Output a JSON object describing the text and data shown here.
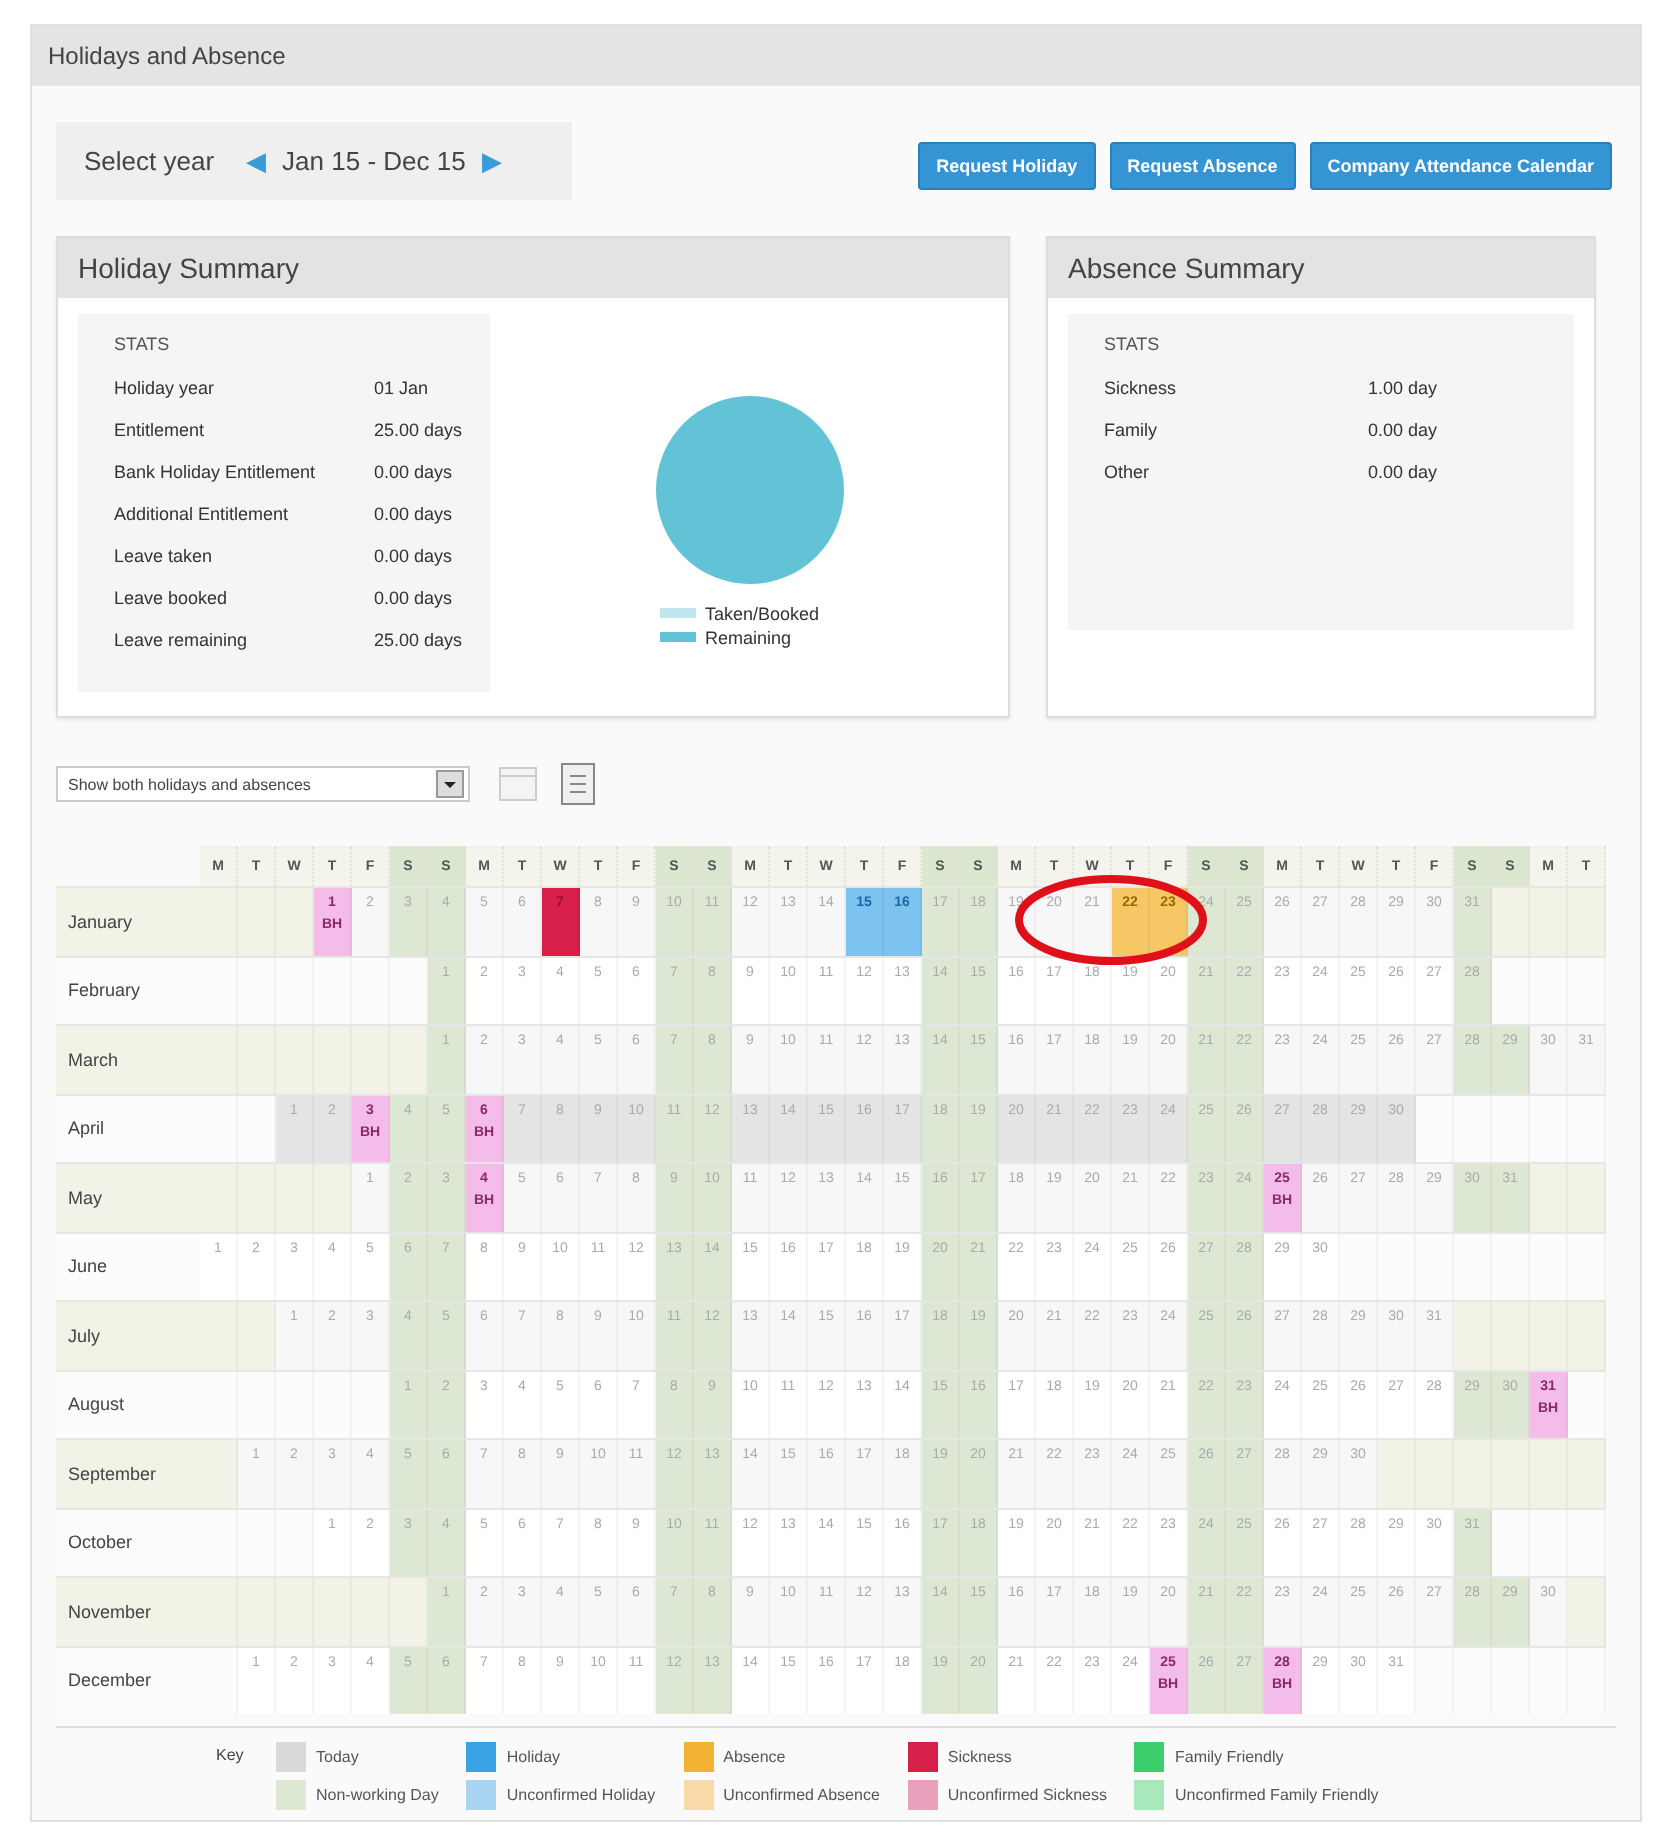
{
  "title": "Holidays and Absence",
  "year_selector": {
    "label": "Select year",
    "prev": "◀",
    "range": "Jan 15 - Dec 15",
    "next": "▶"
  },
  "buttons": [
    "Request Holiday",
    "Request Absence",
    "Company Attendance Calendar"
  ],
  "holiday_summary": {
    "title": "Holiday Summary",
    "stats_heading": "STATS",
    "stats": [
      {
        "label": "Holiday year",
        "value": "01 Jan"
      },
      {
        "label": "Entitlement",
        "value": "25.00 days"
      },
      {
        "label": "Bank Holiday Entitlement",
        "value": "0.00 days"
      },
      {
        "label": "Additional Entitlement",
        "value": "0.00 days"
      },
      {
        "label": "Leave taken",
        "value": "0.00 days"
      },
      {
        "label": "Leave booked",
        "value": "0.00 days"
      },
      {
        "label": "Leave remaining",
        "value": "25.00 days"
      }
    ],
    "legend": [
      {
        "label": "Taken/Booked",
        "color": "#bfe6ef"
      },
      {
        "label": "Remaining",
        "color": "#62c3d6"
      }
    ]
  },
  "absence_summary": {
    "title": "Absence Summary",
    "stats_heading": "STATS",
    "stats": [
      {
        "label": "Sickness",
        "value": "1.00 day"
      },
      {
        "label": "Family",
        "value": "0.00 day"
      },
      {
        "label": "Other",
        "value": "0.00 day"
      }
    ]
  },
  "filter": {
    "value": "Show both holidays and absences"
  },
  "calendar": {
    "weekdays": [
      {
        "label": "M",
        "weekend": false
      },
      {
        "label": "T",
        "weekend": false
      },
      {
        "label": "W",
        "weekend": false
      },
      {
        "label": "T",
        "weekend": false
      },
      {
        "label": "F",
        "weekend": false
      },
      {
        "label": "S",
        "weekend": true
      },
      {
        "label": "S",
        "weekend": true
      },
      {
        "label": "M",
        "weekend": false
      },
      {
        "label": "T",
        "weekend": false
      },
      {
        "label": "W",
        "weekend": false
      },
      {
        "label": "T",
        "weekend": false
      },
      {
        "label": "F",
        "weekend": false
      },
      {
        "label": "S",
        "weekend": true
      },
      {
        "label": "S",
        "weekend": true
      },
      {
        "label": "M",
        "weekend": false
      },
      {
        "label": "T",
        "weekend": false
      },
      {
        "label": "W",
        "weekend": false
      },
      {
        "label": "T",
        "weekend": false
      },
      {
        "label": "F",
        "weekend": false
      },
      {
        "label": "S",
        "weekend": true
      },
      {
        "label": "S",
        "weekend": true
      },
      {
        "label": "M",
        "weekend": false
      },
      {
        "label": "T",
        "weekend": false
      },
      {
        "label": "W",
        "weekend": false
      },
      {
        "label": "T",
        "weekend": false
      },
      {
        "label": "F",
        "weekend": false
      },
      {
        "label": "S",
        "weekend": true
      },
      {
        "label": "S",
        "weekend": true
      },
      {
        "label": "M",
        "weekend": false
      },
      {
        "label": "T",
        "weekend": false
      },
      {
        "label": "W",
        "weekend": false
      },
      {
        "label": "T",
        "weekend": false
      },
      {
        "label": "F",
        "weekend": false
      },
      {
        "label": "S",
        "weekend": true
      },
      {
        "label": "S",
        "weekend": true
      },
      {
        "label": "M",
        "weekend": false
      },
      {
        "label": "T",
        "weekend": false
      }
    ],
    "months": [
      {
        "name": "January",
        "current": false,
        "days": [
          {
            "kind": "blank"
          },
          {
            "kind": "blank"
          },
          {
            "kind": "blank"
          },
          {
            "n": "1",
            "kind": "bank_holiday",
            "note": "BH"
          },
          {
            "n": "2"
          },
          {
            "n": "3"
          },
          {
            "n": "4"
          },
          {
            "n": "5"
          },
          {
            "n": "6"
          },
          {
            "n": "7",
            "kind": "sickness"
          },
          {
            "n": "8"
          },
          {
            "n": "9"
          },
          {
            "n": "10"
          },
          {
            "n": "11"
          },
          {
            "n": "12"
          },
          {
            "n": "13"
          },
          {
            "n": "14"
          },
          {
            "n": "15",
            "kind": "holiday"
          },
          {
            "n": "16",
            "kind": "holiday"
          },
          {
            "n": "17"
          },
          {
            "n": "18"
          },
          {
            "n": "19"
          },
          {
            "n": "20"
          },
          {
            "n": "21"
          },
          {
            "n": "22",
            "kind": "absence"
          },
          {
            "n": "23",
            "kind": "absence"
          },
          {
            "n": "24"
          },
          {
            "n": "25"
          },
          {
            "n": "26"
          },
          {
            "n": "27"
          },
          {
            "n": "28"
          },
          {
            "n": "29"
          },
          {
            "n": "30"
          },
          {
            "n": "31"
          }
        ]
      },
      {
        "name": "February",
        "current": false,
        "days": [
          {
            "kind": "blank"
          },
          {
            "kind": "blank"
          },
          {
            "kind": "blank"
          },
          {
            "kind": "blank"
          },
          {
            "kind": "blank"
          },
          {
            "kind": "blank"
          },
          {
            "n": "1"
          },
          {
            "n": "2"
          },
          {
            "n": "3"
          },
          {
            "n": "4"
          },
          {
            "n": "5"
          },
          {
            "n": "6"
          },
          {
            "n": "7"
          },
          {
            "n": "8"
          },
          {
            "n": "9"
          },
          {
            "n": "10"
          },
          {
            "n": "11"
          },
          {
            "n": "12"
          },
          {
            "n": "13"
          },
          {
            "n": "14"
          },
          {
            "n": "15"
          },
          {
            "n": "16"
          },
          {
            "n": "17"
          },
          {
            "n": "18"
          },
          {
            "n": "19"
          },
          {
            "n": "20"
          },
          {
            "n": "21"
          },
          {
            "n": "22"
          },
          {
            "n": "23"
          },
          {
            "n": "24"
          },
          {
            "n": "25"
          },
          {
            "n": "26"
          },
          {
            "n": "27"
          },
          {
            "n": "28"
          }
        ]
      },
      {
        "name": "March",
        "current": false,
        "days": [
          {
            "kind": "blank"
          },
          {
            "kind": "blank"
          },
          {
            "kind": "blank"
          },
          {
            "kind": "blank"
          },
          {
            "kind": "blank"
          },
          {
            "kind": "blank"
          },
          {
            "n": "1"
          },
          {
            "n": "2"
          },
          {
            "n": "3"
          },
          {
            "n": "4"
          },
          {
            "n": "5"
          },
          {
            "n": "6"
          },
          {
            "n": "7"
          },
          {
            "n": "8"
          },
          {
            "n": "9"
          },
          {
            "n": "10"
          },
          {
            "n": "11"
          },
          {
            "n": "12"
          },
          {
            "n": "13"
          },
          {
            "n": "14"
          },
          {
            "n": "15"
          },
          {
            "n": "16"
          },
          {
            "n": "17"
          },
          {
            "n": "18"
          },
          {
            "n": "19"
          },
          {
            "n": "20"
          },
          {
            "n": "21"
          },
          {
            "n": "22"
          },
          {
            "n": "23"
          },
          {
            "n": "24"
          },
          {
            "n": "25"
          },
          {
            "n": "26"
          },
          {
            "n": "27"
          },
          {
            "n": "28"
          },
          {
            "n": "29"
          },
          {
            "n": "30"
          },
          {
            "n": "31"
          }
        ]
      },
      {
        "name": "April",
        "current": true,
        "days": [
          {
            "kind": "blank"
          },
          {
            "kind": "blank"
          },
          {
            "n": "1"
          },
          {
            "n": "2"
          },
          {
            "n": "3",
            "kind": "bank_holiday",
            "note": "BH"
          },
          {
            "n": "4"
          },
          {
            "n": "5"
          },
          {
            "n": "6",
            "kind": "bank_holiday",
            "note": "BH"
          },
          {
            "n": "7"
          },
          {
            "n": "8"
          },
          {
            "n": "9"
          },
          {
            "n": "10"
          },
          {
            "n": "11"
          },
          {
            "n": "12"
          },
          {
            "n": "13"
          },
          {
            "n": "14"
          },
          {
            "n": "15"
          },
          {
            "n": "16"
          },
          {
            "n": "17"
          },
          {
            "n": "18"
          },
          {
            "n": "19"
          },
          {
            "n": "20"
          },
          {
            "n": "21"
          },
          {
            "n": "22"
          },
          {
            "n": "23"
          },
          {
            "n": "24"
          },
          {
            "n": "25"
          },
          {
            "n": "26"
          },
          {
            "n": "27"
          },
          {
            "n": "28"
          },
          {
            "n": "29"
          },
          {
            "n": "30"
          }
        ]
      },
      {
        "name": "May",
        "current": false,
        "days": [
          {
            "kind": "blank"
          },
          {
            "kind": "blank"
          },
          {
            "kind": "blank"
          },
          {
            "kind": "blank"
          },
          {
            "n": "1"
          },
          {
            "n": "2"
          },
          {
            "n": "3"
          },
          {
            "n": "4",
            "kind": "bank_holiday",
            "note": "BH"
          },
          {
            "n": "5"
          },
          {
            "n": "6"
          },
          {
            "n": "7"
          },
          {
            "n": "8"
          },
          {
            "n": "9"
          },
          {
            "n": "10"
          },
          {
            "n": "11"
          },
          {
            "n": "12"
          },
          {
            "n": "13"
          },
          {
            "n": "14"
          },
          {
            "n": "15"
          },
          {
            "n": "16"
          },
          {
            "n": "17"
          },
          {
            "n": "18"
          },
          {
            "n": "19"
          },
          {
            "n": "20"
          },
          {
            "n": "21"
          },
          {
            "n": "22"
          },
          {
            "n": "23"
          },
          {
            "n": "24"
          },
          {
            "n": "25",
            "kind": "bank_holiday",
            "note": "BH"
          },
          {
            "n": "26"
          },
          {
            "n": "27"
          },
          {
            "n": "28"
          },
          {
            "n": "29"
          },
          {
            "n": "30"
          },
          {
            "n": "31"
          }
        ]
      },
      {
        "name": "June",
        "current": false,
        "days": [
          {
            "n": "1"
          },
          {
            "n": "2"
          },
          {
            "n": "3"
          },
          {
            "n": "4"
          },
          {
            "n": "5"
          },
          {
            "n": "6"
          },
          {
            "n": "7"
          },
          {
            "n": "8"
          },
          {
            "n": "9"
          },
          {
            "n": "10"
          },
          {
            "n": "11"
          },
          {
            "n": "12"
          },
          {
            "n": "13"
          },
          {
            "n": "14"
          },
          {
            "n": "15"
          },
          {
            "n": "16"
          },
          {
            "n": "17"
          },
          {
            "n": "18"
          },
          {
            "n": "19"
          },
          {
            "n": "20"
          },
          {
            "n": "21"
          },
          {
            "n": "22"
          },
          {
            "n": "23"
          },
          {
            "n": "24"
          },
          {
            "n": "25"
          },
          {
            "n": "26"
          },
          {
            "n": "27"
          },
          {
            "n": "28"
          },
          {
            "n": "29"
          },
          {
            "n": "30"
          }
        ]
      },
      {
        "name": "July",
        "current": false,
        "days": [
          {
            "kind": "blank"
          },
          {
            "kind": "blank"
          },
          {
            "n": "1"
          },
          {
            "n": "2"
          },
          {
            "n": "3"
          },
          {
            "n": "4"
          },
          {
            "n": "5"
          },
          {
            "n": "6"
          },
          {
            "n": "7"
          },
          {
            "n": "8"
          },
          {
            "n": "9"
          },
          {
            "n": "10"
          },
          {
            "n": "11"
          },
          {
            "n": "12"
          },
          {
            "n": "13"
          },
          {
            "n": "14"
          },
          {
            "n": "15"
          },
          {
            "n": "16"
          },
          {
            "n": "17"
          },
          {
            "n": "18"
          },
          {
            "n": "19"
          },
          {
            "n": "20"
          },
          {
            "n": "21"
          },
          {
            "n": "22"
          },
          {
            "n": "23"
          },
          {
            "n": "24"
          },
          {
            "n": "25"
          },
          {
            "n": "26"
          },
          {
            "n": "27"
          },
          {
            "n": "28"
          },
          {
            "n": "29"
          },
          {
            "n": "30"
          },
          {
            "n": "31"
          }
        ]
      },
      {
        "name": "August",
        "current": false,
        "days": [
          {
            "kind": "blank"
          },
          {
            "kind": "blank"
          },
          {
            "kind": "blank"
          },
          {
            "kind": "blank"
          },
          {
            "kind": "blank"
          },
          {
            "n": "1"
          },
          {
            "n": "2"
          },
          {
            "n": "3"
          },
          {
            "n": "4"
          },
          {
            "n": "5"
          },
          {
            "n": "6"
          },
          {
            "n": "7"
          },
          {
            "n": "8"
          },
          {
            "n": "9"
          },
          {
            "n": "10"
          },
          {
            "n": "11"
          },
          {
            "n": "12"
          },
          {
            "n": "13"
          },
          {
            "n": "14"
          },
          {
            "n": "15"
          },
          {
            "n": "16"
          },
          {
            "n": "17"
          },
          {
            "n": "18"
          },
          {
            "n": "19"
          },
          {
            "n": "20"
          },
          {
            "n": "21"
          },
          {
            "n": "22"
          },
          {
            "n": "23"
          },
          {
            "n": "24"
          },
          {
            "n": "25"
          },
          {
            "n": "26"
          },
          {
            "n": "27"
          },
          {
            "n": "28"
          },
          {
            "n": "29"
          },
          {
            "n": "30"
          },
          {
            "n": "31",
            "kind": "bank_holiday",
            "note": "BH"
          }
        ]
      },
      {
        "name": "September",
        "current": false,
        "days": [
          {
            "kind": "blank"
          },
          {
            "n": "1"
          },
          {
            "n": "2"
          },
          {
            "n": "3"
          },
          {
            "n": "4"
          },
          {
            "n": "5"
          },
          {
            "n": "6"
          },
          {
            "n": "7"
          },
          {
            "n": "8"
          },
          {
            "n": "9"
          },
          {
            "n": "10"
          },
          {
            "n": "11"
          },
          {
            "n": "12"
          },
          {
            "n": "13"
          },
          {
            "n": "14"
          },
          {
            "n": "15"
          },
          {
            "n": "16"
          },
          {
            "n": "17"
          },
          {
            "n": "18"
          },
          {
            "n": "19"
          },
          {
            "n": "20"
          },
          {
            "n": "21"
          },
          {
            "n": "22"
          },
          {
            "n": "23"
          },
          {
            "n": "24"
          },
          {
            "n": "25"
          },
          {
            "n": "26"
          },
          {
            "n": "27"
          },
          {
            "n": "28"
          },
          {
            "n": "29"
          },
          {
            "n": "30"
          }
        ]
      },
      {
        "name": "October",
        "current": false,
        "days": [
          {
            "kind": "blank"
          },
          {
            "kind": "blank"
          },
          {
            "kind": "blank"
          },
          {
            "n": "1"
          },
          {
            "n": "2"
          },
          {
            "n": "3"
          },
          {
            "n": "4"
          },
          {
            "n": "5"
          },
          {
            "n": "6"
          },
          {
            "n": "7"
          },
          {
            "n": "8"
          },
          {
            "n": "9"
          },
          {
            "n": "10"
          },
          {
            "n": "11"
          },
          {
            "n": "12"
          },
          {
            "n": "13"
          },
          {
            "n": "14"
          },
          {
            "n": "15"
          },
          {
            "n": "16"
          },
          {
            "n": "17"
          },
          {
            "n": "18"
          },
          {
            "n": "19"
          },
          {
            "n": "20"
          },
          {
            "n": "21"
          },
          {
            "n": "22"
          },
          {
            "n": "23"
          },
          {
            "n": "24"
          },
          {
            "n": "25"
          },
          {
            "n": "26"
          },
          {
            "n": "27"
          },
          {
            "n": "28"
          },
          {
            "n": "29"
          },
          {
            "n": "30"
          },
          {
            "n": "31"
          }
        ]
      },
      {
        "name": "November",
        "current": false,
        "days": [
          {
            "kind": "blank"
          },
          {
            "kind": "blank"
          },
          {
            "kind": "blank"
          },
          {
            "kind": "blank"
          },
          {
            "kind": "blank"
          },
          {
            "kind": "blank"
          },
          {
            "n": "1"
          },
          {
            "n": "2"
          },
          {
            "n": "3"
          },
          {
            "n": "4"
          },
          {
            "n": "5"
          },
          {
            "n": "6"
          },
          {
            "n": "7"
          },
          {
            "n": "8"
          },
          {
            "n": "9"
          },
          {
            "n": "10"
          },
          {
            "n": "11"
          },
          {
            "n": "12"
          },
          {
            "n": "13"
          },
          {
            "n": "14"
          },
          {
            "n": "15"
          },
          {
            "n": "16"
          },
          {
            "n": "17"
          },
          {
            "n": "18"
          },
          {
            "n": "19"
          },
          {
            "n": "20"
          },
          {
            "n": "21"
          },
          {
            "n": "22"
          },
          {
            "n": "23"
          },
          {
            "n": "24"
          },
          {
            "n": "25"
          },
          {
            "n": "26"
          },
          {
            "n": "27"
          },
          {
            "n": "28"
          },
          {
            "n": "29"
          },
          {
            "n": "30"
          }
        ]
      },
      {
        "name": "December",
        "current": false,
        "days": [
          {
            "kind": "blank"
          },
          {
            "n": "1"
          },
          {
            "n": "2"
          },
          {
            "n": "3"
          },
          {
            "n": "4"
          },
          {
            "n": "5"
          },
          {
            "n": "6"
          },
          {
            "n": "7"
          },
          {
            "n": "8"
          },
          {
            "n": "9"
          },
          {
            "n": "10"
          },
          {
            "n": "11"
          },
          {
            "n": "12"
          },
          {
            "n": "13"
          },
          {
            "n": "14"
          },
          {
            "n": "15"
          },
          {
            "n": "16"
          },
          {
            "n": "17"
          },
          {
            "n": "18"
          },
          {
            "n": "19"
          },
          {
            "n": "20"
          },
          {
            "n": "21"
          },
          {
            "n": "22"
          },
          {
            "n": "23"
          },
          {
            "n": "24"
          },
          {
            "n": "25",
            "kind": "bank_holiday",
            "note": "BH"
          },
          {
            "n": "26"
          },
          {
            "n": "27"
          },
          {
            "n": "28",
            "kind": "bank_holiday",
            "note": "BH"
          },
          {
            "n": "29"
          },
          {
            "n": "30"
          },
          {
            "n": "31"
          }
        ]
      }
    ]
  },
  "key": {
    "label": "Key",
    "items": [
      {
        "label": "Today",
        "color": "#d9d9d9"
      },
      {
        "label": "Non-working Day",
        "color": "#dde8d4"
      },
      {
        "label": "Holiday",
        "color": "#3aa3e3"
      },
      {
        "label": "Unconfirmed Holiday",
        "color": "#a9d5f3"
      },
      {
        "label": "Absence",
        "color": "#f2b233"
      },
      {
        "label": "Unconfirmed Absence",
        "color": "#fad9a8"
      },
      {
        "label": "Sickness",
        "color": "#d6204a"
      },
      {
        "label": "Unconfirmed Sickness",
        "color": "#e9a0bd"
      },
      {
        "label": "Family Friendly",
        "color": "#3ccf6c"
      },
      {
        "label": "Unconfirmed Family Friendly",
        "color": "#a8e8bb"
      }
    ]
  }
}
